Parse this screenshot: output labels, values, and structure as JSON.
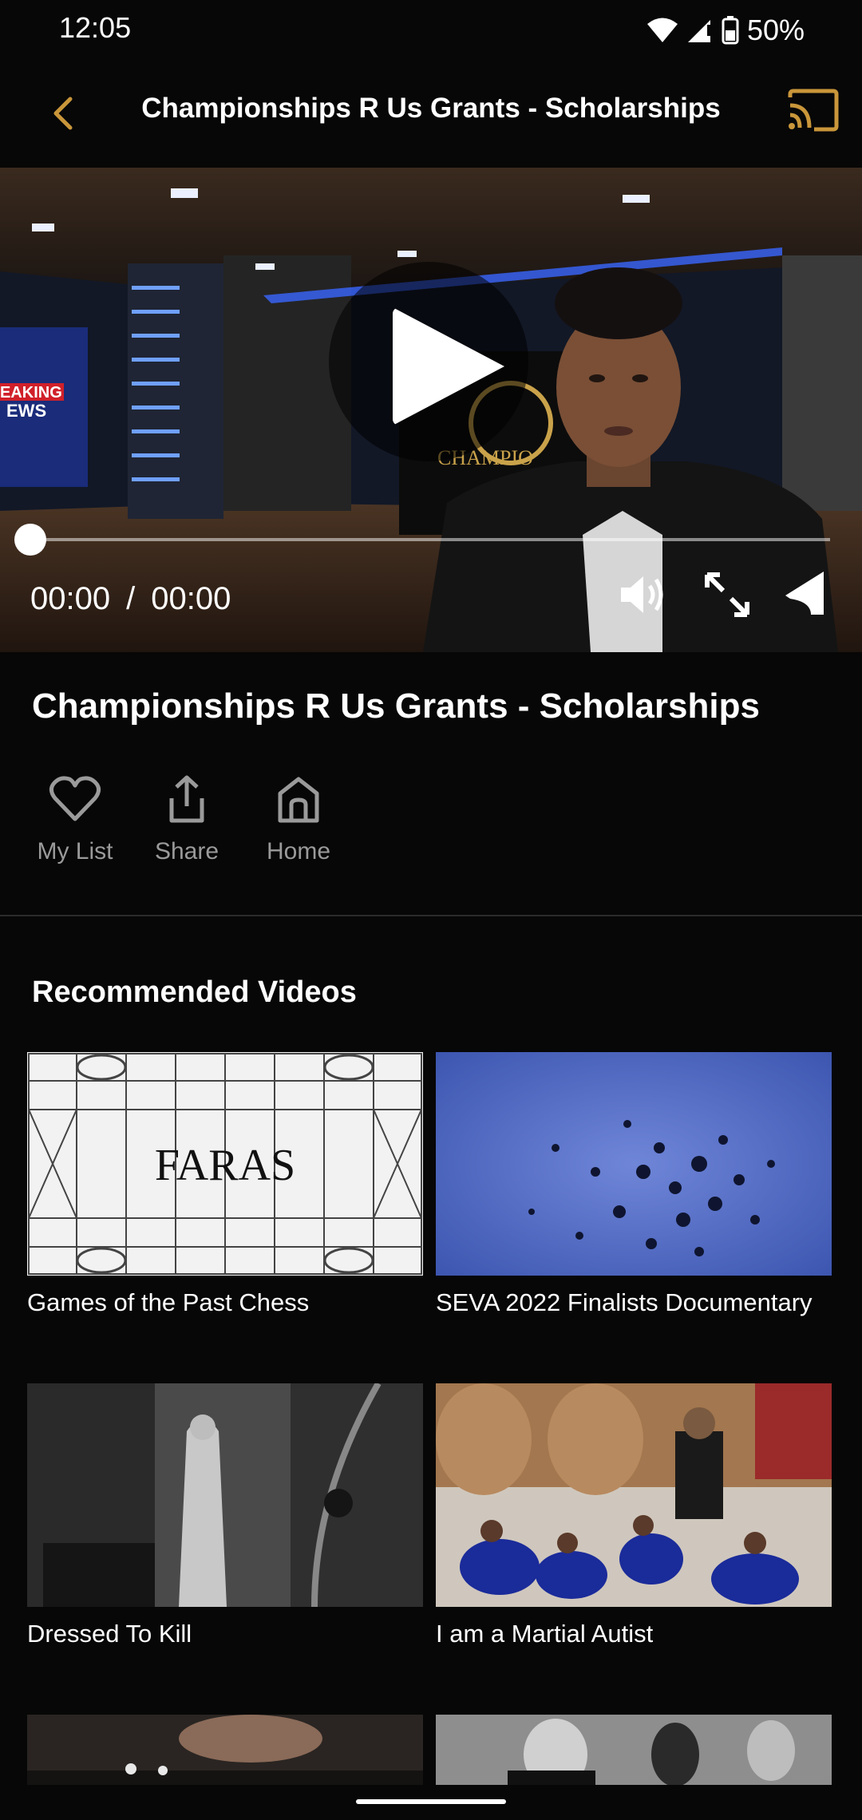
{
  "status_bar": {
    "time": "12:05",
    "battery": "50%"
  },
  "app_bar": {
    "title": "Championships R Us Grants - Scholarships"
  },
  "video": {
    "current_time": "00:00",
    "separator": "/",
    "duration": "00:00",
    "progress": 0,
    "scene_text": {
      "news_line1": "EAKING",
      "news_line2": "EWS",
      "logo_text": "CHAMPIO"
    }
  },
  "details": {
    "title": "Championships R Us Grants - Scholarships",
    "actions": {
      "my_list": "My List",
      "share": "Share",
      "home": "Home"
    }
  },
  "recommended": {
    "heading": "Recommended Videos",
    "items": [
      {
        "title": "Games of the Past Chess",
        "thumb_text": "FARAS"
      },
      {
        "title": "SEVA 2022 Finalists Documentary"
      },
      {
        "title": "Dressed To Kill"
      },
      {
        "title": "I am a Martial Autist"
      },
      {
        "title": ""
      },
      {
        "title": ""
      }
    ]
  },
  "colors": {
    "accent": "#c9963a",
    "background": "#070707",
    "muted": "#9a9a9a"
  }
}
